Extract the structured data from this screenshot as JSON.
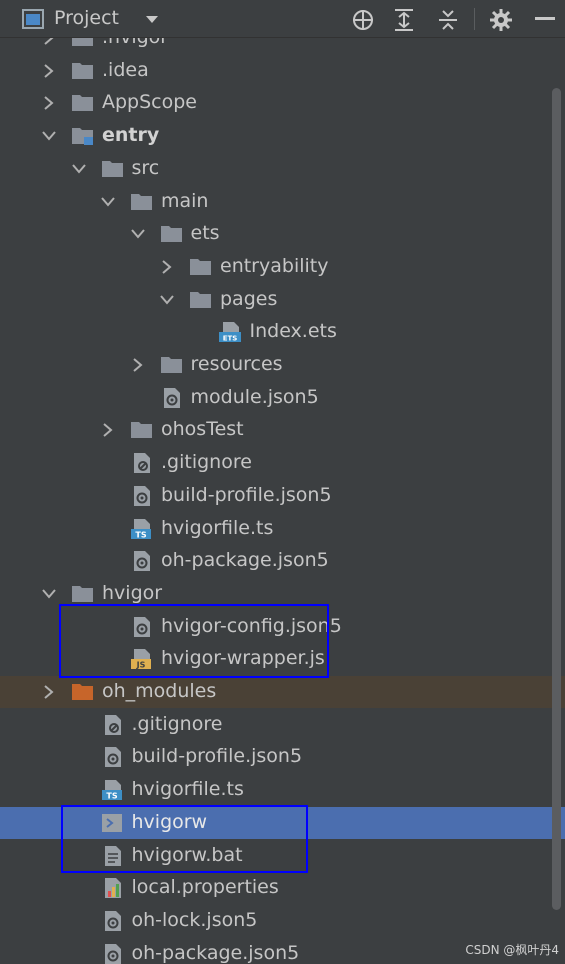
{
  "toolbar": {
    "title": "Project",
    "icons": [
      "project-view-icon",
      "dropdown-icon",
      "locate-icon",
      "expand-all-icon",
      "collapse-all-icon",
      "settings-icon",
      "hide-icon"
    ]
  },
  "tree": [
    {
      "label": ".hvigor",
      "level": 1,
      "type": "folder",
      "arrow": "right",
      "partial": true
    },
    {
      "label": ".idea",
      "level": 1,
      "type": "folder",
      "arrow": "right"
    },
    {
      "label": "AppScope",
      "level": 1,
      "type": "folder",
      "arrow": "right"
    },
    {
      "label": "entry",
      "level": 1,
      "type": "module",
      "arrow": "down",
      "bold": true
    },
    {
      "label": "src",
      "level": 2,
      "type": "folder",
      "arrow": "down"
    },
    {
      "label": "main",
      "level": 3,
      "type": "folder",
      "arrow": "down"
    },
    {
      "label": "ets",
      "level": 4,
      "type": "folder",
      "arrow": "down"
    },
    {
      "label": "entryability",
      "level": 5,
      "type": "folder",
      "arrow": "right"
    },
    {
      "label": "pages",
      "level": 5,
      "type": "folder",
      "arrow": "down"
    },
    {
      "label": "Index.ets",
      "level": 6,
      "type": "ets",
      "arrow": "none"
    },
    {
      "label": "resources",
      "level": 4,
      "type": "folder",
      "arrow": "right"
    },
    {
      "label": "module.json5",
      "level": 4,
      "type": "json",
      "arrow": "none"
    },
    {
      "label": "ohosTest",
      "level": 3,
      "type": "folder",
      "arrow": "right"
    },
    {
      "label": ".gitignore",
      "level": 3,
      "type": "ignore",
      "arrow": "none"
    },
    {
      "label": "build-profile.json5",
      "level": 3,
      "type": "json",
      "arrow": "none"
    },
    {
      "label": "hvigorfile.ts",
      "level": 3,
      "type": "ts",
      "arrow": "none"
    },
    {
      "label": "oh-package.json5",
      "level": 3,
      "type": "json",
      "arrow": "none"
    },
    {
      "label": "hvigor",
      "level": 1,
      "type": "folder",
      "arrow": "down"
    },
    {
      "label": "hvigor-config.json5",
      "level": 3,
      "type": "json",
      "arrow": "none"
    },
    {
      "label": "hvigor-wrapper.js",
      "level": 3,
      "type": "js",
      "arrow": "none"
    },
    {
      "label": "oh_modules",
      "level": 1,
      "type": "folder-orange",
      "arrow": "right",
      "highlight": "modules"
    },
    {
      "label": ".gitignore",
      "level": 2,
      "type": "ignore",
      "arrow": "none"
    },
    {
      "label": "build-profile.json5",
      "level": 2,
      "type": "json",
      "arrow": "none"
    },
    {
      "label": "hvigorfile.ts",
      "level": 2,
      "type": "ts",
      "arrow": "none"
    },
    {
      "label": "hvigorw",
      "level": 2,
      "type": "shell",
      "arrow": "none",
      "highlight": "selected"
    },
    {
      "label": "hvigorw.bat",
      "level": 2,
      "type": "text",
      "arrow": "none"
    },
    {
      "label": "local.properties",
      "level": 2,
      "type": "properties",
      "arrow": "none"
    },
    {
      "label": "oh-lock.json5",
      "level": 2,
      "type": "json",
      "arrow": "none"
    },
    {
      "label": "oh-package.json5",
      "level": 2,
      "type": "json",
      "arrow": "none"
    }
  ],
  "watermark": "CSDN @枫叶丹4",
  "colors": {
    "background": "#3c3f41",
    "selected": "#4b6eaf",
    "modules_highlight": "#4a4136",
    "annotation_box": "#0000ff",
    "folder": "#8a9099",
    "folder_orange": "#c7652a"
  }
}
